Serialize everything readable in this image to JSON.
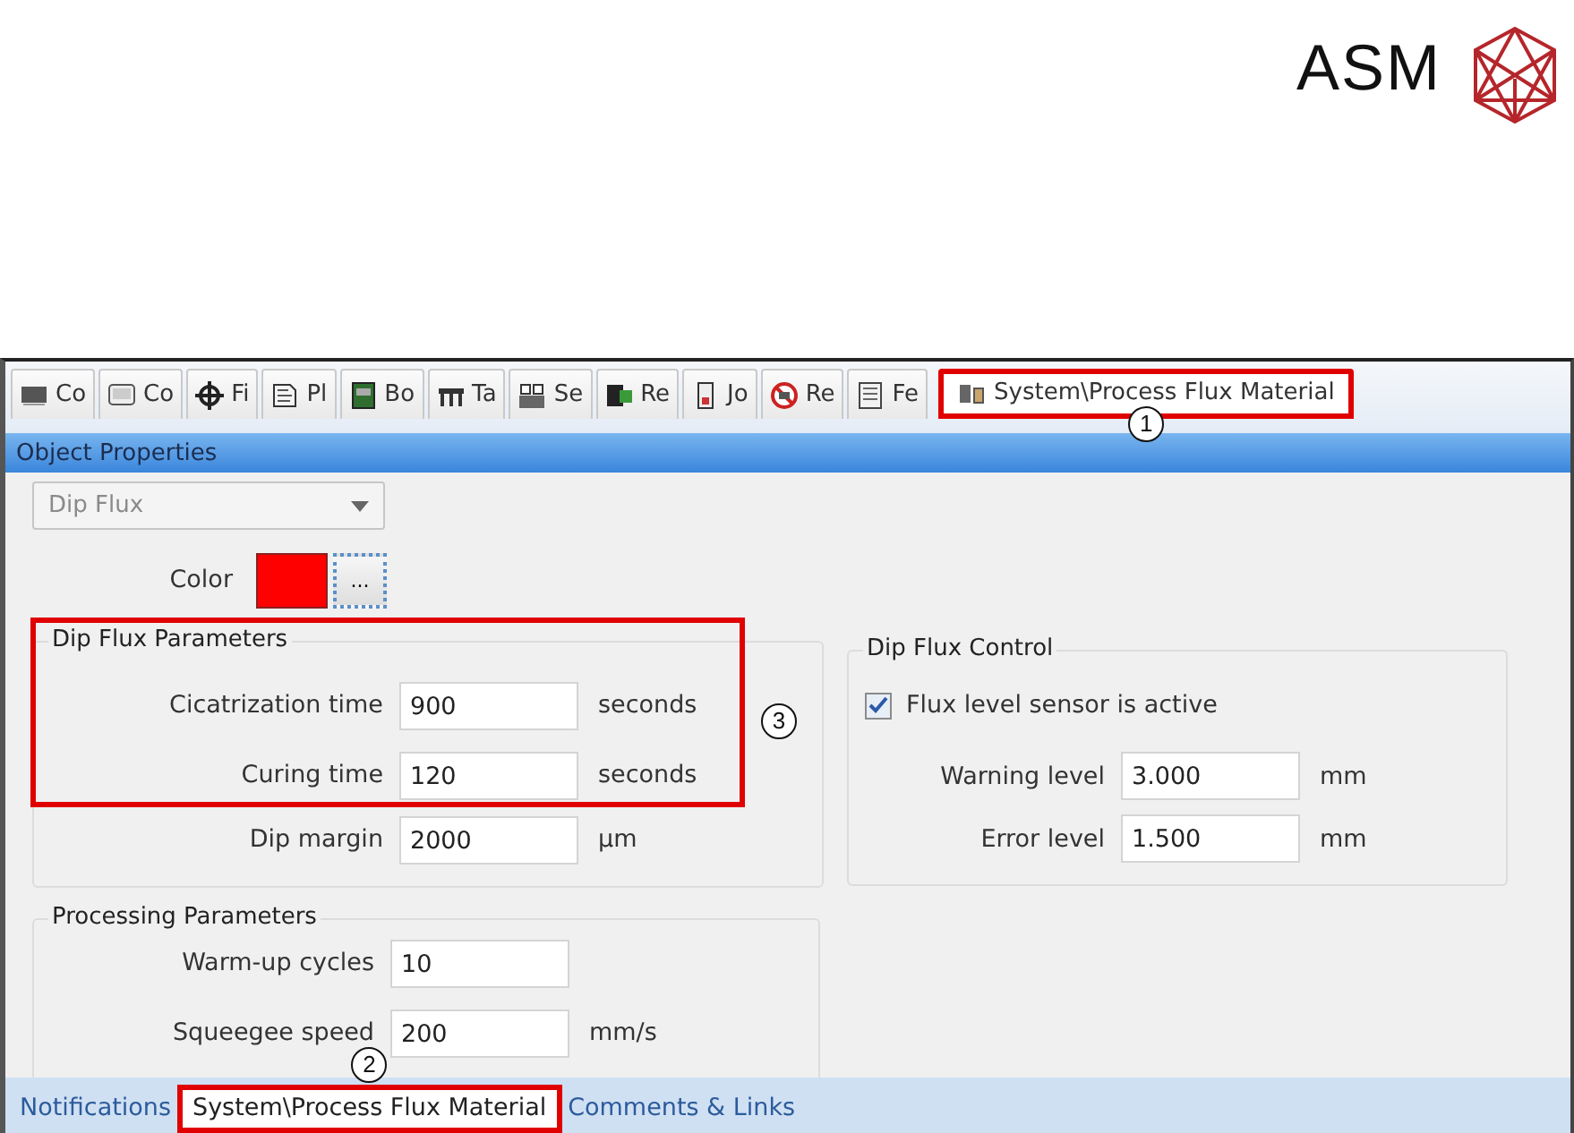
{
  "logo": {
    "text": "ASM"
  },
  "tabs": [
    {
      "label": "Co",
      "selected": false
    },
    {
      "label": "Co",
      "selected": false
    },
    {
      "label": "Fi",
      "selected": false
    },
    {
      "label": "Pl",
      "selected": false
    },
    {
      "label": "Bo",
      "selected": false
    },
    {
      "label": "Ta",
      "selected": false
    },
    {
      "label": "Se",
      "selected": false
    },
    {
      "label": "Re",
      "selected": false
    },
    {
      "label": "Jo",
      "selected": false
    },
    {
      "label": "Re",
      "selected": false
    },
    {
      "label": "Fe",
      "selected": false
    },
    {
      "label": "System\\Process Flux Material",
      "selected": true,
      "callout": "1"
    }
  ],
  "panel_title": "Object Properties",
  "dropdown": {
    "value": "Dip Flux",
    "disabled": true
  },
  "color_row": {
    "label": "Color",
    "color": "#ff0000",
    "button": "..."
  },
  "dip_flux_parameters": {
    "title": "Dip Flux Parameters",
    "callout": "3",
    "fields": [
      {
        "label": "Cicatrization time",
        "value": "900",
        "unit": "seconds"
      },
      {
        "label": "Curing time",
        "value": "120",
        "unit": "seconds"
      },
      {
        "label": "Dip margin",
        "value": "2000",
        "unit": "µm"
      }
    ]
  },
  "dip_flux_control": {
    "title": "Dip Flux Control",
    "checkbox": {
      "label": "Flux level sensor is active",
      "checked": true
    },
    "fields": [
      {
        "label": "Warning level",
        "value": "3.000",
        "unit": "mm"
      },
      {
        "label": "Error level",
        "value": "1.500",
        "unit": "mm"
      }
    ]
  },
  "processing_parameters": {
    "title": "Processing Parameters",
    "fields": [
      {
        "label": "Warm-up cycles",
        "value": "10"
      },
      {
        "label": "Squeegee speed",
        "value": "200",
        "unit": "mm/s"
      }
    ]
  },
  "bottom_tabs": [
    {
      "label": "Notifications",
      "selected": false
    },
    {
      "label": "System\\Process Flux Material",
      "selected": true,
      "callout": "2"
    },
    {
      "label": "Comments & Links",
      "selected": false
    }
  ]
}
